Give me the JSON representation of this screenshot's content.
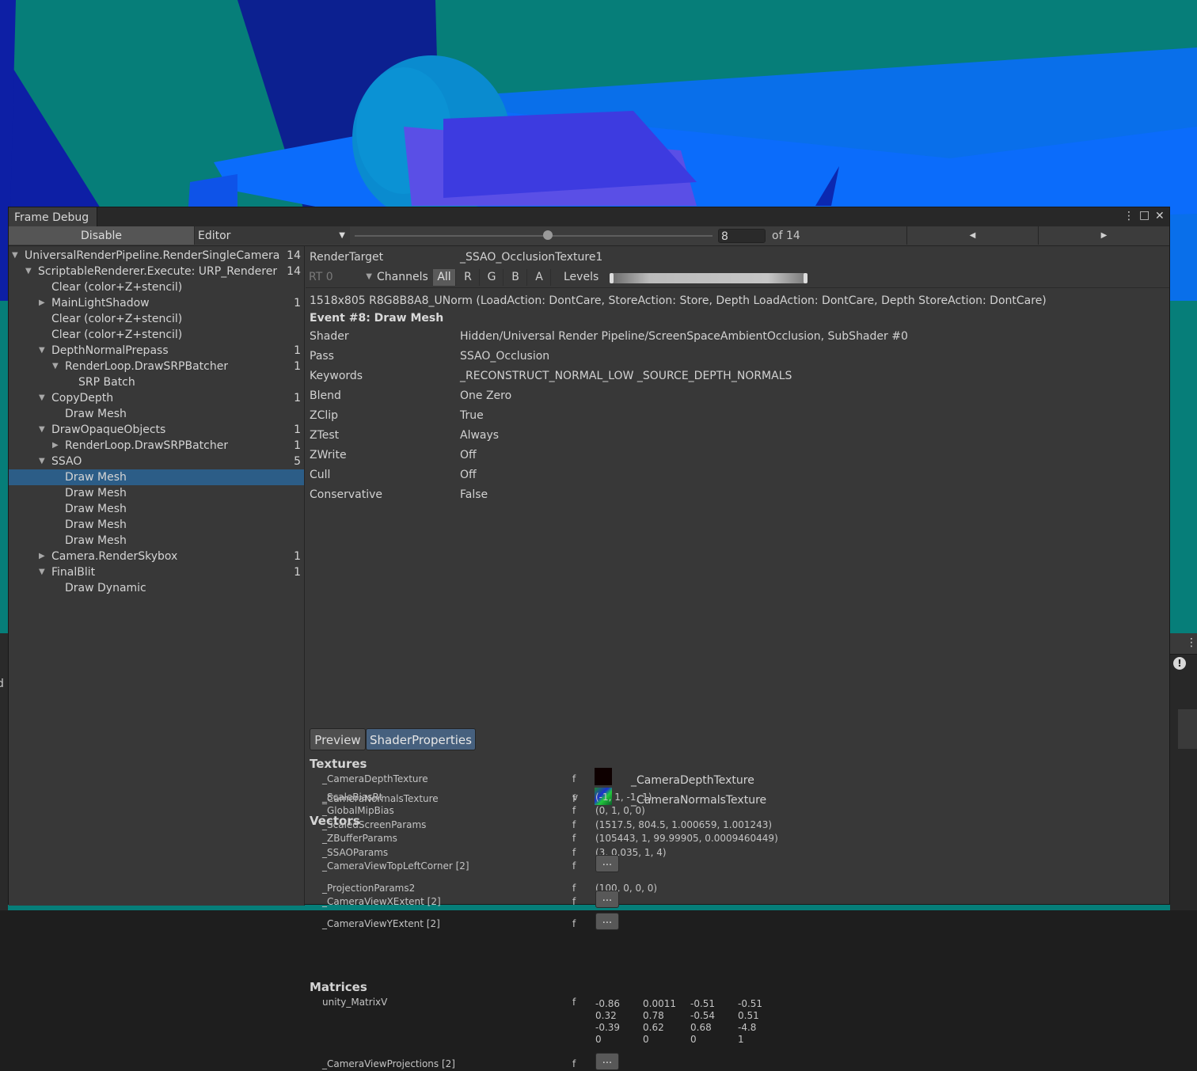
{
  "window": {
    "title": "Frame Debug",
    "menu_icon": "⋮",
    "maximize_icon": "□",
    "close_icon": "✕"
  },
  "toolbar": {
    "disable_label": "Disable",
    "target_select": "Editor",
    "event_index": "8",
    "event_total_label": "of 14",
    "slider_position": 0.54,
    "prev_icon": "◀",
    "next_icon": "▶"
  },
  "tree": {
    "items": [
      {
        "label": "UniversalRenderPipeline.RenderSingleCamera",
        "count": "14",
        "depth": 0,
        "fold": "▼"
      },
      {
        "label": "ScriptableRenderer.Execute: URP_Renderer",
        "count": "14",
        "depth": 1,
        "fold": "▼"
      },
      {
        "label": "Clear (color+Z+stencil)",
        "count": "",
        "depth": 2,
        "fold": ""
      },
      {
        "label": "MainLightShadow",
        "count": "1",
        "depth": 2,
        "fold": "▶"
      },
      {
        "label": "Clear (color+Z+stencil)",
        "count": "",
        "depth": 2,
        "fold": ""
      },
      {
        "label": "Clear (color+Z+stencil)",
        "count": "",
        "depth": 2,
        "fold": ""
      },
      {
        "label": "DepthNormalPrepass",
        "count": "1",
        "depth": 2,
        "fold": "▼"
      },
      {
        "label": "RenderLoop.DrawSRPBatcher",
        "count": "1",
        "depth": 3,
        "fold": "▼"
      },
      {
        "label": "SRP Batch",
        "count": "",
        "depth": 4,
        "fold": ""
      },
      {
        "label": "CopyDepth",
        "count": "1",
        "depth": 2,
        "fold": "▼"
      },
      {
        "label": "Draw Mesh",
        "count": "",
        "depth": 3,
        "fold": ""
      },
      {
        "label": "DrawOpaqueObjects",
        "count": "1",
        "depth": 2,
        "fold": "▼"
      },
      {
        "label": "RenderLoop.DrawSRPBatcher",
        "count": "1",
        "depth": 3,
        "fold": "▶"
      },
      {
        "label": "SSAO",
        "count": "5",
        "depth": 2,
        "fold": "▼"
      },
      {
        "label": "Draw Mesh",
        "count": "",
        "depth": 3,
        "fold": "",
        "selected": true
      },
      {
        "label": "Draw Mesh",
        "count": "",
        "depth": 3,
        "fold": ""
      },
      {
        "label": "Draw Mesh",
        "count": "",
        "depth": 3,
        "fold": ""
      },
      {
        "label": "Draw Mesh",
        "count": "",
        "depth": 3,
        "fold": ""
      },
      {
        "label": "Draw Mesh",
        "count": "",
        "depth": 3,
        "fold": ""
      },
      {
        "label": "Camera.RenderSkybox",
        "count": "1",
        "depth": 2,
        "fold": "▶"
      },
      {
        "label": "FinalBlit",
        "count": "1",
        "depth": 2,
        "fold": "▼"
      },
      {
        "label": "Draw Dynamic",
        "count": "",
        "depth": 3,
        "fold": ""
      }
    ]
  },
  "details": {
    "render_target_label": "RenderTarget",
    "render_target_value": "_SSAO_OcclusionTexture1",
    "rt_select": "RT 0",
    "channels_label": "Channels",
    "channels": [
      "All",
      "R",
      "G",
      "B",
      "A"
    ],
    "levels_label": "Levels",
    "format_line": "1518x805 R8G8B8A8_UNorm (LoadAction: DontCare, StoreAction: Store, Depth LoadAction: DontCare, Depth StoreAction: DontCare)",
    "event_title": "Event #8: Draw Mesh",
    "props": [
      {
        "k": "Shader",
        "v": "Hidden/Universal Render Pipeline/ScreenSpaceAmbientOcclusion, SubShader #0"
      },
      {
        "k": "Pass",
        "v": "SSAO_Occlusion"
      },
      {
        "k": "Keywords",
        "v": "_RECONSTRUCT_NORMAL_LOW _SOURCE_DEPTH_NORMALS"
      },
      {
        "k": "Blend",
        "v": "One Zero"
      },
      {
        "k": "ZClip",
        "v": "True"
      },
      {
        "k": "ZTest",
        "v": "Always"
      },
      {
        "k": "ZWrite",
        "v": "Off"
      },
      {
        "k": "Cull",
        "v": "Off"
      },
      {
        "k": "Conservative",
        "v": "False"
      }
    ],
    "tabs": [
      "Preview",
      "ShaderProperties"
    ],
    "textures_title": "Textures",
    "textures": [
      {
        "name": "_CameraDepthTexture",
        "type": "f",
        "value": "_CameraDepthTexture"
      },
      {
        "name": "_CameraNormalsTexture",
        "type": "f",
        "value": "_CameraNormalsTexture"
      }
    ],
    "vectors_title": "Vectors",
    "vectors": [
      {
        "name": "_ScaleBiasRt",
        "type": "v",
        "value": "(-1, 1, -1, 1)"
      },
      {
        "name": "_GlobalMipBias",
        "type": "f",
        "value": "(0, 1, 0, 0)"
      },
      {
        "name": "_ScaledScreenParams",
        "type": "f",
        "value": "(1517.5, 804.5, 1.000659, 1.001243)"
      },
      {
        "name": "_ZBufferParams",
        "type": "f",
        "value": "(105443, 1, 99.99905, 0.0009460449)"
      },
      {
        "name": "_SSAOParams",
        "type": "f",
        "value": "(3, 0.035, 1, 4)"
      },
      {
        "name": "_CameraViewTopLeftCorner [2]",
        "type": "f",
        "value": "..."
      },
      {
        "name": "_ProjectionParams2",
        "type": "f",
        "value": "(100, 0, 0, 0)"
      },
      {
        "name": "_CameraViewXExtent [2]",
        "type": "f",
        "value": "..."
      },
      {
        "name": "_CameraViewYExtent [2]",
        "type": "f",
        "value": "..."
      }
    ],
    "matrices_title": "Matrices",
    "matrix_name": "unity_MatrixV",
    "matrix_type": "f",
    "matrix": [
      [
        "-0.86",
        "0.0011",
        "-0.51",
        "-0.51"
      ],
      [
        "0.32",
        "0.78",
        "-0.54",
        "0.51"
      ],
      [
        "-0.39",
        "0.62",
        "0.68",
        "-4.8"
      ],
      [
        "0",
        "0",
        "0",
        "1"
      ]
    ],
    "last_matrix_name": "_CameraViewProjections [2]",
    "last_matrix_type": "f",
    "last_matrix_value": "..."
  },
  "background": {
    "right_dots": "⋮",
    "warning_icon": "!",
    "left_text": "d"
  }
}
